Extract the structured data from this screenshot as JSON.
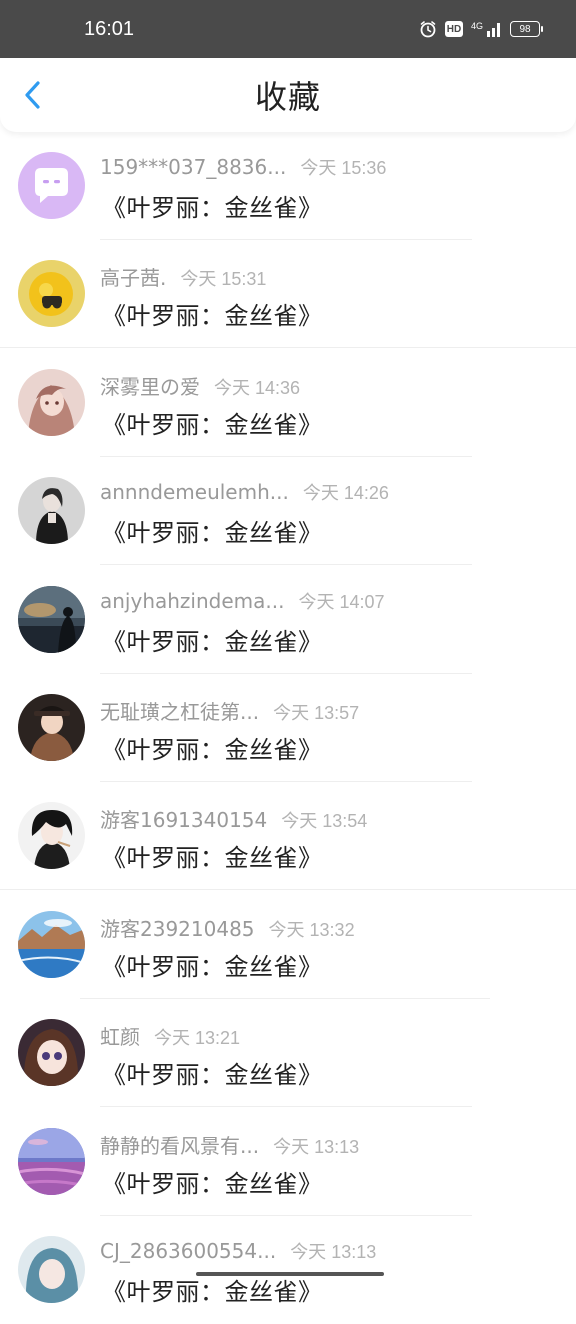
{
  "status_bar": {
    "time": "16:01",
    "hd": "HD",
    "network": "4G",
    "battery": "98"
  },
  "header": {
    "title": "收藏"
  },
  "items": [
    {
      "username": "159***037_8836...",
      "time": "今天 15:36",
      "book": "《叶罗丽：金丝雀》"
    },
    {
      "username": "高子茜.",
      "time": "今天 15:31",
      "book": "《叶罗丽：金丝雀》"
    },
    {
      "username": "深雾里の爱",
      "time": "今天 14:36",
      "book": "《叶罗丽：金丝雀》"
    },
    {
      "username": "annndemeulemh...",
      "time": "今天 14:26",
      "book": "《叶罗丽：金丝雀》"
    },
    {
      "username": "anjyhahzindema...",
      "time": "今天 14:07",
      "book": "《叶罗丽：金丝雀》"
    },
    {
      "username": "无耻璜之杠徒第...",
      "time": "今天 13:57",
      "book": "《叶罗丽：金丝雀》"
    },
    {
      "username": "游客1691340154",
      "time": "今天 13:54",
      "book": "《叶罗丽：金丝雀》"
    },
    {
      "username": "游客239210485",
      "time": "今天 13:32",
      "book": "《叶罗丽：金丝雀》"
    },
    {
      "username": "虹颜",
      "time": "今天 13:21",
      "book": "《叶罗丽：金丝雀》"
    },
    {
      "username": "静静的看风景有...",
      "time": "今天 13:13",
      "book": "《叶罗丽：金丝雀》"
    },
    {
      "username": "CJ_2863600554...",
      "time": "今天 13:13",
      "book": "《叶罗丽：金丝雀》"
    }
  ],
  "colors": {
    "accent": "#2f9bf0",
    "status_bar": "#4a4a4a"
  }
}
